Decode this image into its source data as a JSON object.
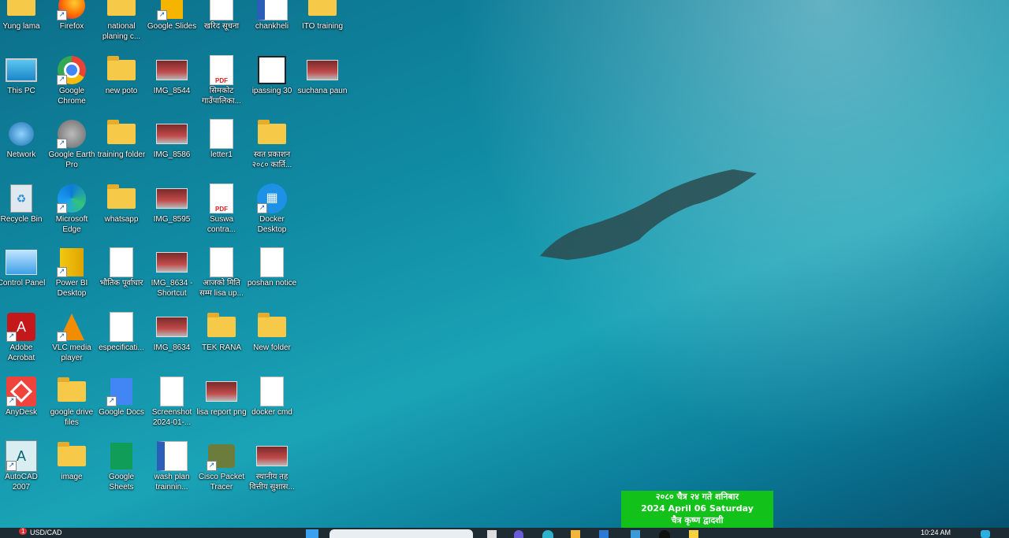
{
  "desktop": {
    "icons": [
      {
        "label": "Yung lama",
        "icon": "folder-user-icon"
      },
      {
        "label": "Firefox",
        "icon": "firefox-icon"
      },
      {
        "label": "national planing c...",
        "icon": "folder-icon"
      },
      {
        "label": "Google Slides",
        "icon": "google-slides-icon"
      },
      {
        "label": "खरिद सूचना",
        "icon": "document-icon"
      },
      {
        "label": "chankheli",
        "icon": "word-icon"
      },
      {
        "label": "ITO training",
        "icon": "folder-icon"
      },
      {
        "label": "This PC",
        "icon": "this-pc-icon"
      },
      {
        "label": "Google Chrome",
        "icon": "chrome-icon"
      },
      {
        "label": "new poto",
        "icon": "folder-icon"
      },
      {
        "label": "IMG_8544",
        "icon": "photo-icon"
      },
      {
        "label": "सिमकोट गाउँपालिका...",
        "icon": "pdf-icon"
      },
      {
        "label": "ipassing 30",
        "icon": "app-icon"
      },
      {
        "label": "suchana paun",
        "icon": "photo-icon"
      },
      {
        "label": "Network",
        "icon": "network-icon"
      },
      {
        "label": "Google Earth Pro",
        "icon": "google-earth-icon"
      },
      {
        "label": "training folder",
        "icon": "folder-icon"
      },
      {
        "label": "IMG_8586",
        "icon": "photo-icon"
      },
      {
        "label": "letter1",
        "icon": "document-icon"
      },
      {
        "label": "स्वत प्रकाशन २०८० कार्ति...",
        "icon": "folder-icon"
      },
      {
        "label": "Recycle Bin",
        "icon": "recycle-bin-icon"
      },
      {
        "label": "Microsoft Edge",
        "icon": "edge-icon"
      },
      {
        "label": "whatsapp",
        "icon": "folder-icon"
      },
      {
        "label": "IMG_8595",
        "icon": "photo-icon"
      },
      {
        "label": "Suswa contra...",
        "icon": "pdf-icon"
      },
      {
        "label": "Docker Desktop",
        "icon": "docker-icon"
      },
      {
        "label": "Control Panel",
        "icon": "control-panel-icon"
      },
      {
        "label": "Power BI Desktop",
        "icon": "power-bi-icon"
      },
      {
        "label": "भौतिक पूर्वाधार",
        "icon": "document-icon"
      },
      {
        "label": "IMG_8634 - Shortcut",
        "icon": "photo-icon"
      },
      {
        "label": "आजको मिति सम्म lisa up...",
        "icon": "document-icon"
      },
      {
        "label": "poshan notice",
        "icon": "document-icon"
      },
      {
        "label": "Adobe Acrobat",
        "icon": "acrobat-icon"
      },
      {
        "label": "VLC media player",
        "icon": "vlc-icon"
      },
      {
        "label": "especificati...",
        "icon": "document-icon"
      },
      {
        "label": "IMG_8634",
        "icon": "photo-icon"
      },
      {
        "label": "TEK RANA",
        "icon": "folder-icon"
      },
      {
        "label": "New folder",
        "icon": "folder-icon"
      },
      {
        "label": "AnyDesk",
        "icon": "anydesk-icon"
      },
      {
        "label": "google drive files",
        "icon": "folder-icon"
      },
      {
        "label": "Google Docs",
        "icon": "google-docs-icon"
      },
      {
        "label": "Screenshot 2024-01-...",
        "icon": "document-icon"
      },
      {
        "label": "lisa report png",
        "icon": "photo-icon"
      },
      {
        "label": "docker cmd",
        "icon": "document-icon"
      },
      {
        "label": "AutoCAD 2007",
        "icon": "autocad-icon"
      },
      {
        "label": "image",
        "icon": "folder-icon"
      },
      {
        "label": "Google Sheets",
        "icon": "google-sheets-icon"
      },
      {
        "label": "wash plan trainnin...",
        "icon": "word-icon"
      },
      {
        "label": "Cisco Packet Tracer",
        "icon": "cisco-icon"
      },
      {
        "label": "स्थानीय तह वित्तीय सुशास...",
        "icon": "photo-icon"
      }
    ]
  },
  "calendar": {
    "line1": "२०८० चैत्र २४ गते शनिबार",
    "line2": "2024 April 06  Saturday",
    "line3": "चैत्र  कृष्ण द्वादशी"
  },
  "taskbar": {
    "notification_badge": "1",
    "ticker": "USD/CAD",
    "clock": "10:24 AM"
  }
}
